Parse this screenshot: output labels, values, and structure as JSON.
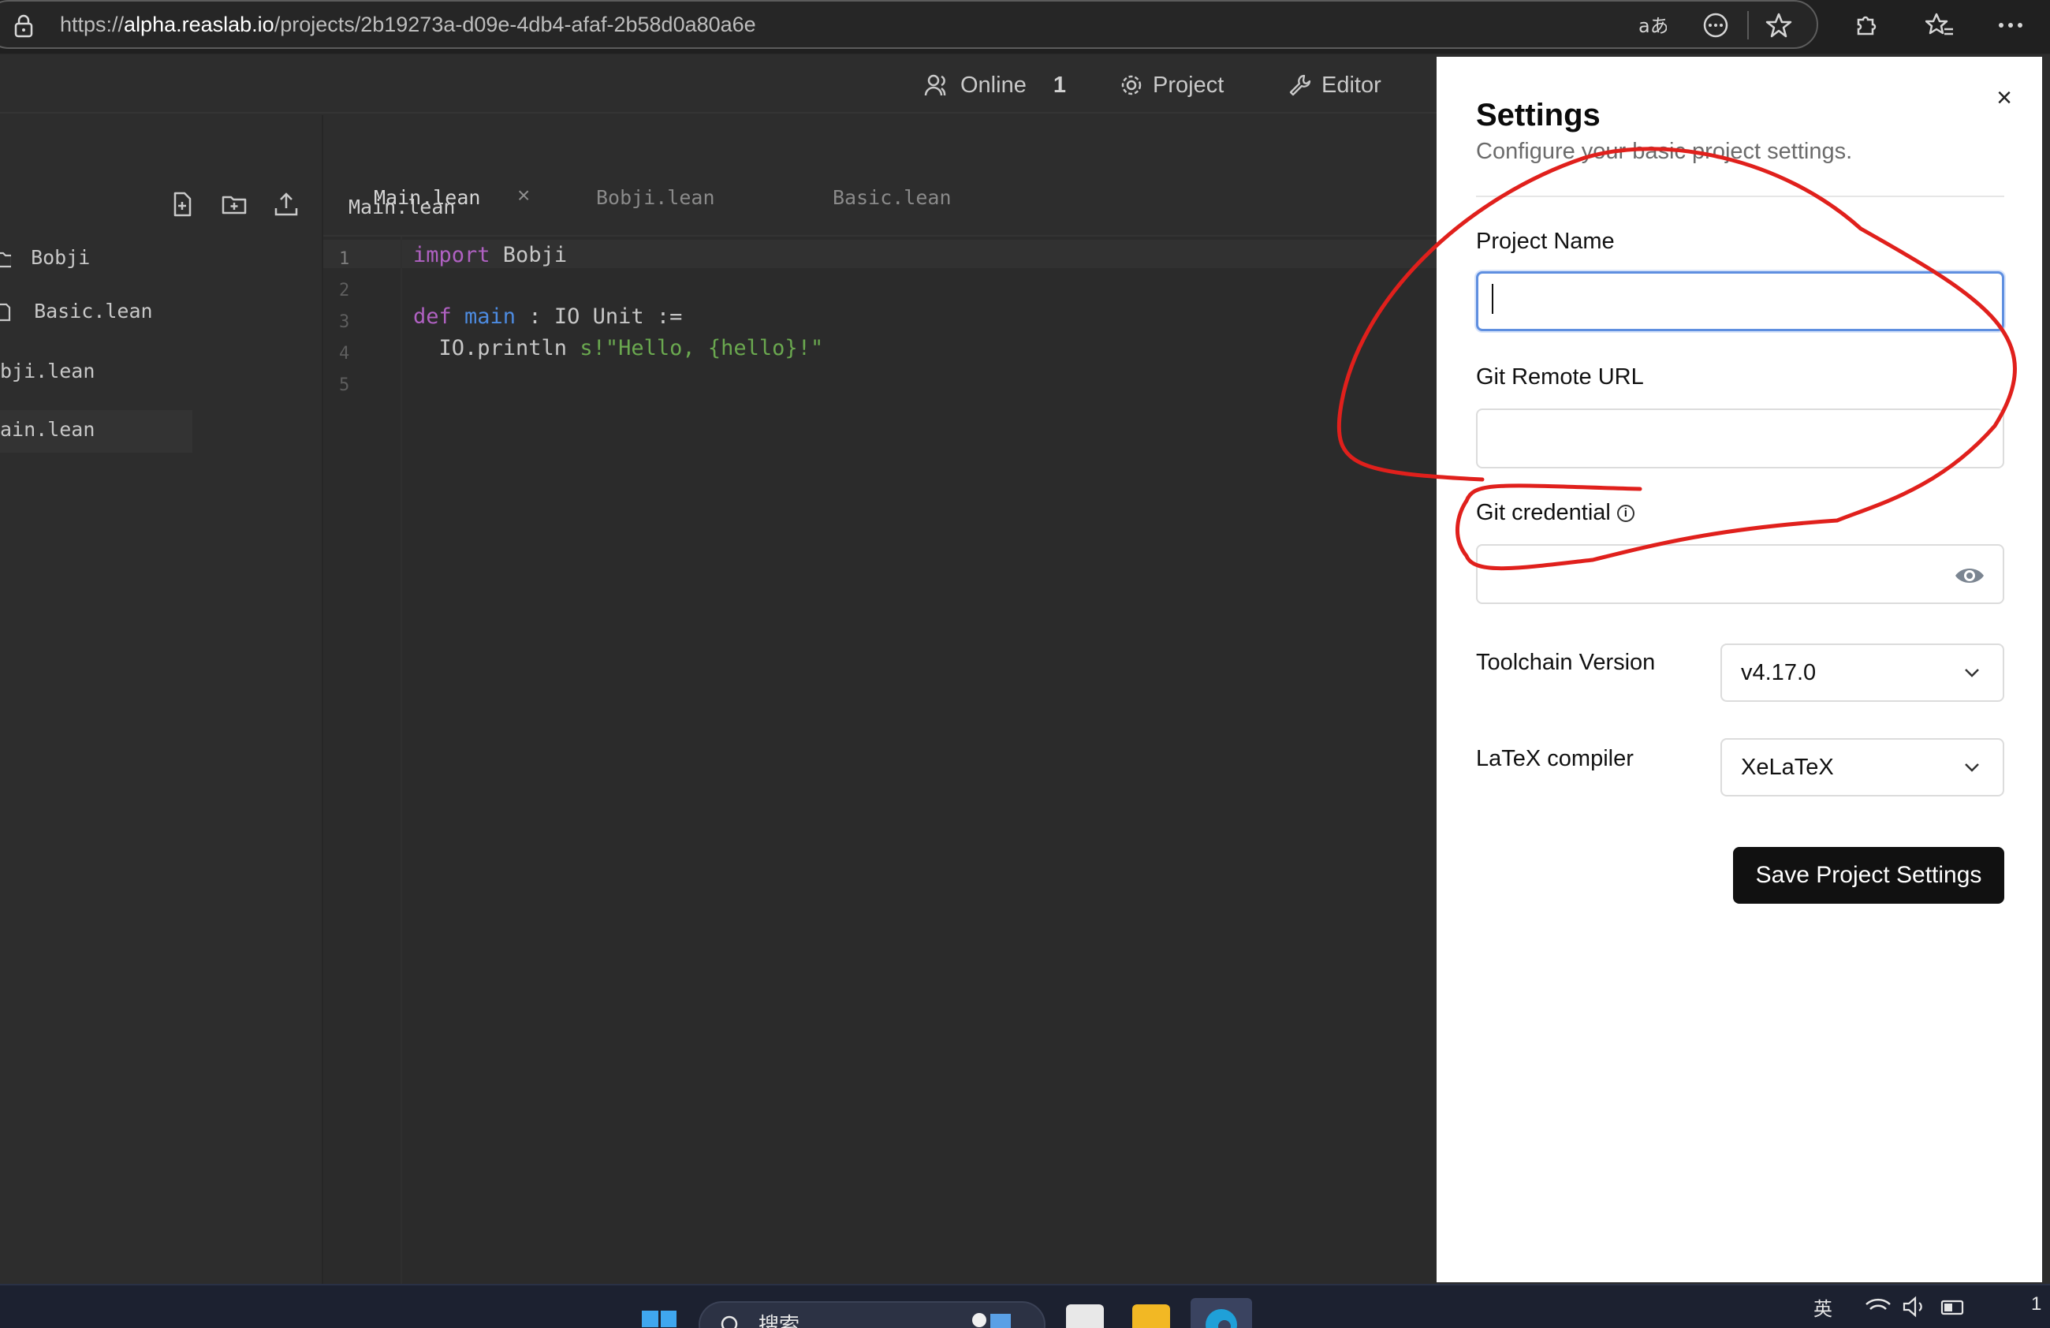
{
  "browser": {
    "url_scheme": "https://",
    "url_host": "alpha.reaslab.io",
    "url_path": "/projects/2b19273a-d09e-4db4-afaf-2b58d0a80a6e",
    "icons": [
      "read-aloud-icon",
      "page-menu-icon",
      "favorite-star-icon",
      "extensions-icon",
      "favorites-icon",
      "more-icon"
    ]
  },
  "topbar": {
    "online_label": "Online",
    "online_count": "1",
    "project_label": "Project",
    "editor_label": "Editor"
  },
  "sidebar": {
    "tree": [
      {
        "label": "Bobji"
      },
      {
        "label": "Basic.lean"
      },
      {
        "label": "bji.lean"
      },
      {
        "label": "ain.lean"
      }
    ]
  },
  "tabs": [
    {
      "label": "Main.lean",
      "close": "×"
    },
    {
      "label": "Bobji.lean"
    },
    {
      "label": "Basic.lean"
    }
  ],
  "breadcrumb": "Main.lean",
  "editor": {
    "line_numbers": [
      "1",
      "2",
      "3",
      "4",
      "5"
    ],
    "code": {
      "l1_kw": "import",
      "l1_rest": " Bobji",
      "l3_kw": "def",
      "l3_fn": " main",
      "l3_rest": " : IO Unit :=",
      "l4_a": "  IO.println ",
      "l4_s": "s!\"Hello, ",
      "l4_b": "{hello}",
      "l4_e": "!\""
    }
  },
  "settings": {
    "title": "Settings",
    "subtitle": "Configure your basic project settings.",
    "close": "×",
    "project_name_label": "Project Name",
    "project_name_value": "",
    "git_remote_label": "Git Remote URL",
    "git_remote_value": "",
    "git_credential_label": "Git credential",
    "git_credential_info": "i",
    "git_credential_value": "",
    "toolchain_label": "Toolchain Version",
    "toolchain_value": "v4.17.0",
    "latex_label": "LaTeX compiler",
    "latex_value": "XeLaTeX",
    "save_label": "Save Project Settings"
  },
  "taskbar": {
    "search_text": "搜索",
    "tray_lang": "英",
    "clock_partial": "1"
  },
  "colors": {
    "annotation": "#e0201c",
    "focus_border": "#5f8fe0",
    "save_button": "#111111"
  }
}
